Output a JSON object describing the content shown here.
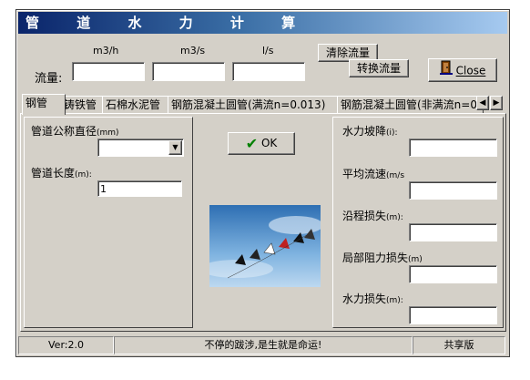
{
  "window": {
    "title": "管 道 水 力 计 算"
  },
  "flow": {
    "label": "流量:",
    "units": [
      "m3/h",
      "m3/s",
      "l/s"
    ],
    "values": [
      "",
      "",
      ""
    ],
    "clear_button": "清除流量",
    "convert_button": "转换流量",
    "close_button": "Close"
  },
  "tabs": [
    "钢管",
    "铸铁管",
    "石棉水泥管",
    "钢筋混凝土圆管(满流n=0.013)",
    "钢筋混凝土圆管(非满流n=0"
  ],
  "left": {
    "diameter_label": "管道公称直径",
    "diameter_unit": "(mm)",
    "diameter_value": "",
    "length_label": "管道长度",
    "length_unit": "(m):",
    "length_value": "1"
  },
  "ok_button": "OK",
  "results": [
    {
      "label": "水力坡降",
      "unit": "(i):",
      "value": ""
    },
    {
      "label": "平均流速",
      "unit": "(m/s",
      "value": ""
    },
    {
      "label": "沿程损失",
      "unit": "(m):",
      "value": ""
    },
    {
      "label": "局部阻力损失",
      "unit": "(m)",
      "value": ""
    },
    {
      "label": "水力损失",
      "unit": "(m):",
      "value": ""
    }
  ],
  "status": {
    "version": "Ver:2.0",
    "message": "不停的跋涉,是生就是命运!",
    "license": "共享版"
  }
}
